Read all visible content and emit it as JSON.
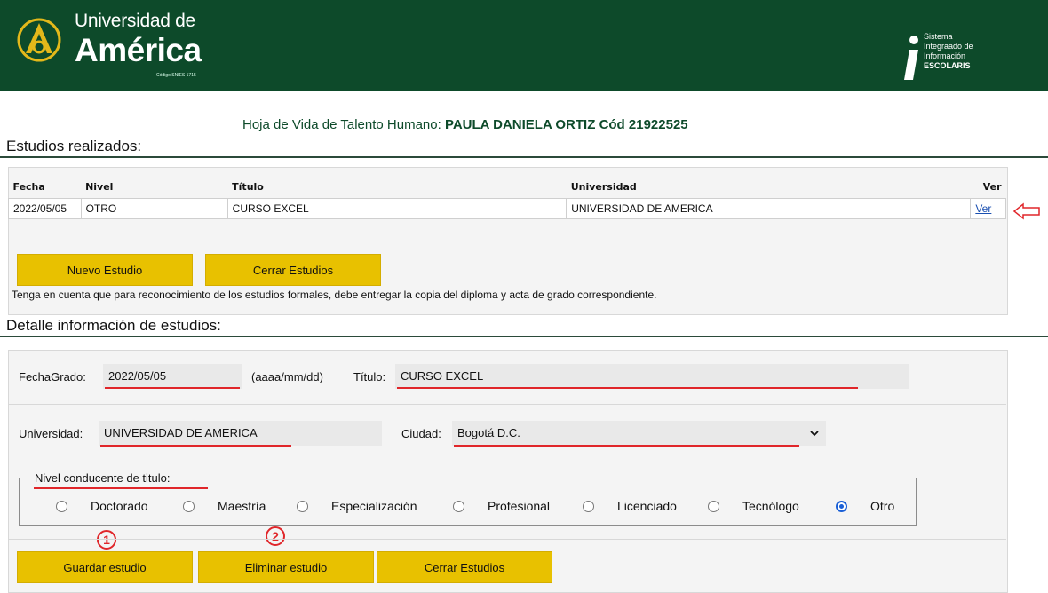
{
  "header": {
    "logo_line1": "Universidad de",
    "logo_line2": "América",
    "logo_code": "Código SNIES 1715",
    "system_line1": "Sistema",
    "system_line2": "Integraado de",
    "system_line3": "Información",
    "system_line4": "ESCOLARIS"
  },
  "page": {
    "title_prefix": "Hoja de Vida de Talento Humano:",
    "person": "PAULA DANIELA ORTIZ",
    "code_label": "Cód",
    "code": "21922525"
  },
  "studies": {
    "section_title": "Estudios realizados:",
    "columns": [
      "Fecha",
      "Nivel",
      "Título",
      "Universidad",
      "Ver"
    ],
    "rows": [
      {
        "fecha": "2022/05/05",
        "nivel": "OTRO",
        "titulo": "CURSO EXCEL",
        "universidad": "UNIVERSIDAD DE AMERICA",
        "ver": "Ver"
      }
    ],
    "new_button": "Nuevo Estudio",
    "close_button": "Cerrar Estudios",
    "note": "Tenga en cuenta que para reconocimiento de los estudios formales, debe entregar la copia del diploma y acta de grado correspondiente."
  },
  "detail": {
    "section_title": "Detalle información de estudios:",
    "fecha_label": "FechaGrado:",
    "fecha_value": "2022/05/05",
    "fecha_hint": "(aaaa/mm/dd)",
    "titulo_label": "Título:",
    "titulo_value": "CURSO EXCEL",
    "universidad_label": "Universidad:",
    "universidad_value": "UNIVERSIDAD DE AMERICA",
    "ciudad_label": "Ciudad:",
    "ciudad_value": "Bogotá D.C.",
    "nivel_legend": "Nivel conducente de titulo:",
    "niveles": [
      "Doctorado",
      "Maestría",
      "Especialización",
      "Profesional",
      "Licenciado",
      "Tecnólogo",
      "Otro"
    ],
    "nivel_selected": "Otro",
    "save_button": "Guardar estudio",
    "delete_button": "Eliminar estudio",
    "close_button": "Cerrar Estudios",
    "marker_1": "1",
    "marker_2": "2"
  }
}
